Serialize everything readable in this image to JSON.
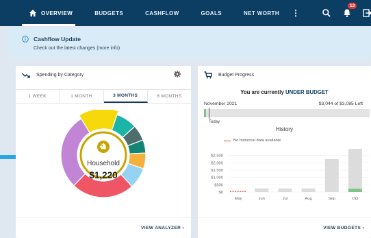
{
  "nav": {
    "items": [
      "OVERVIEW",
      "BUDGETS",
      "CASHFLOW",
      "GOALS",
      "NET WORTH"
    ],
    "more_icon": "kebab-menu-icon",
    "notification_count": "13"
  },
  "banner": {
    "title": "Cashflow Update",
    "subtitle": "Check out the latest changes (more info)"
  },
  "spending": {
    "title": "Spending by Category",
    "tabs": [
      "1 WEEK",
      "1 MONTH",
      "3 MONTHS",
      "6 MONTHS"
    ],
    "active_tab": "3 MONTHS",
    "category": "Household",
    "amount": "$1,220",
    "link": "VIEW ANALYZER",
    "segments": [
      {
        "color": "#f5d90a",
        "share": 0.14
      },
      {
        "color": "#1bb5a8",
        "share": 0.08
      },
      {
        "color": "#4e6e6e",
        "share": 0.06
      },
      {
        "color": "#138577",
        "share": 0.05
      },
      {
        "color": "#f4b03c",
        "share": 0.06
      },
      {
        "color": "#96d2f2",
        "share": 0.08
      },
      {
        "color": "#f05566",
        "share": 0.24
      },
      {
        "color": "#c285d6",
        "share": 0.29
      }
    ]
  },
  "budget": {
    "title": "Budget Progress",
    "status_prefix": "You are currently ",
    "status_highlight": "UNDER BUDGET",
    "month": "November 2021",
    "left": "$3,044 of $3,085 Left",
    "progress": 0.013,
    "today": "Today",
    "history_title": "History",
    "legend": "No historical data available",
    "link": "VIEW BUDGETS"
  },
  "chart_data": {
    "type": "bar",
    "title": "History",
    "categories": [
      "May",
      "Jun",
      "Jul",
      "Aug",
      "Sep",
      "Oct"
    ],
    "series": [
      {
        "values": [
          0,
          250,
          250,
          250,
          2250,
          2950
        ]
      },
      {
        "values": [
          0,
          0,
          0,
          0,
          0,
          230
        ]
      }
    ],
    "yticks": [
      "$2,500",
      "$2,000",
      "$1,500",
      "$1,000",
      "$500",
      "$0"
    ],
    "ylim": [
      0,
      3000
    ],
    "colors": [
      "#dcdcdc",
      "#7fc58a",
      "#d23232"
    ],
    "legend": "No historical data available"
  }
}
